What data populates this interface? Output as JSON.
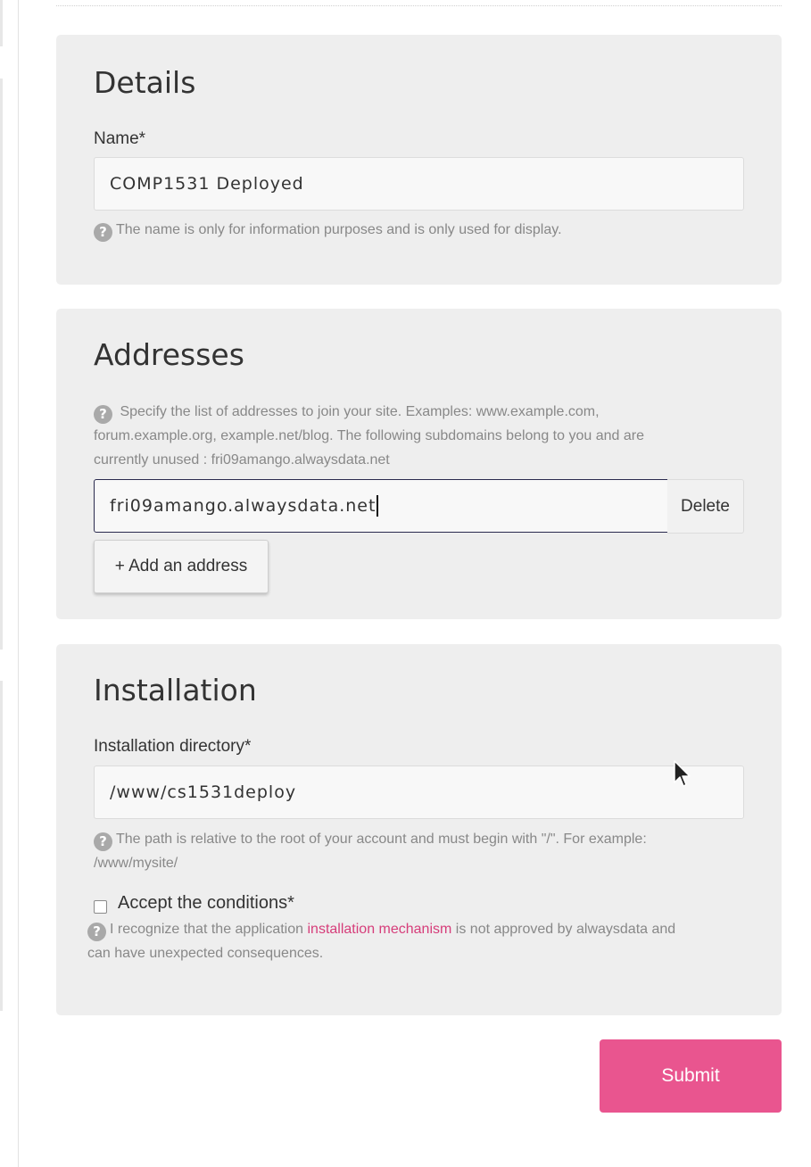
{
  "details": {
    "title": "Details",
    "name_label": "Name*",
    "name_value": "COMP1531 Deployed",
    "name_help": "The name is only for information purposes and is only used for display."
  },
  "addresses": {
    "title": "Addresses",
    "help_line1": "Specify the list of addresses to join your site. Examples: www.example.com,",
    "help_line2": "forum.example.org, example.net/blog. The following subdomains belong to you and are",
    "help_line3": "currently unused : fri09amango.alwaysdata.net",
    "address_value": "fri09amango.alwaysdata.net",
    "delete_label": "Delete",
    "add_label": "+ Add an address"
  },
  "installation": {
    "title": "Installation",
    "dir_label": "Installation directory*",
    "dir_value": "/www/cs1531deploy",
    "dir_help_line1": "The path is relative to the root of your account and must begin with \"/\". For example:",
    "dir_help_line2": "/www/mysite/",
    "accept_label": "Accept the conditions*",
    "accept_checked": false,
    "conditions_prefix": "I recognize that the application ",
    "conditions_link": "installation mechanism",
    "conditions_suffix": " is not approved by alwaysdata and",
    "conditions_line2": "can have unexpected consequences."
  },
  "submit_label": "Submit",
  "colors": {
    "accent": "#e9558f",
    "link": "#d63d7a",
    "panel": "#eeeeee"
  },
  "icons": [
    "help-icon",
    "mouse-pointer-icon"
  ]
}
